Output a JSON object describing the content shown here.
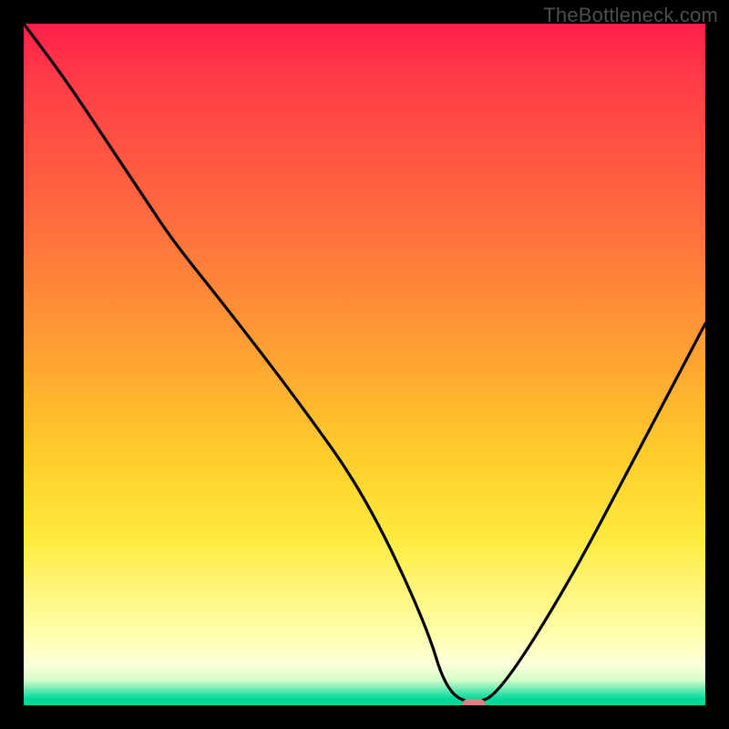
{
  "watermark": {
    "text": "TheBottleneck.com"
  },
  "colors": {
    "frame": "#000000",
    "curve_stroke": "#000000",
    "marker_fill": "#de8083",
    "gradient_stops": [
      "#ff1f4a",
      "#ff3b47",
      "#ff6a3f",
      "#ff9a34",
      "#ffc92a",
      "#ffe93a",
      "#fff57a",
      "#ffffb0",
      "#fdffda",
      "#d4ffca",
      "#89efb9",
      "#2fe0a9",
      "#00d79a",
      "#00d491"
    ]
  },
  "chart_data": {
    "type": "line",
    "title": "",
    "xlabel": "",
    "ylabel": "",
    "xlim": [
      0,
      100
    ],
    "ylim": [
      0,
      100
    ],
    "legend": false,
    "grid": false,
    "note": "V-shaped bottleneck curve over red-yellow-green gradient; minimum near x≈66. Axes carry no tick labels.",
    "series": [
      {
        "name": "bottleneck-curve",
        "x": [
          0,
          6,
          12,
          18,
          22,
          30,
          40,
          50,
          59,
          62,
          66,
          70,
          80,
          90,
          100
        ],
        "y": [
          100,
          92,
          83,
          74,
          68,
          58,
          45,
          31,
          12,
          2,
          0,
          2,
          18,
          37,
          56
        ]
      }
    ],
    "marker": {
      "x": 66,
      "y": 0,
      "label": "optimal-point"
    }
  }
}
